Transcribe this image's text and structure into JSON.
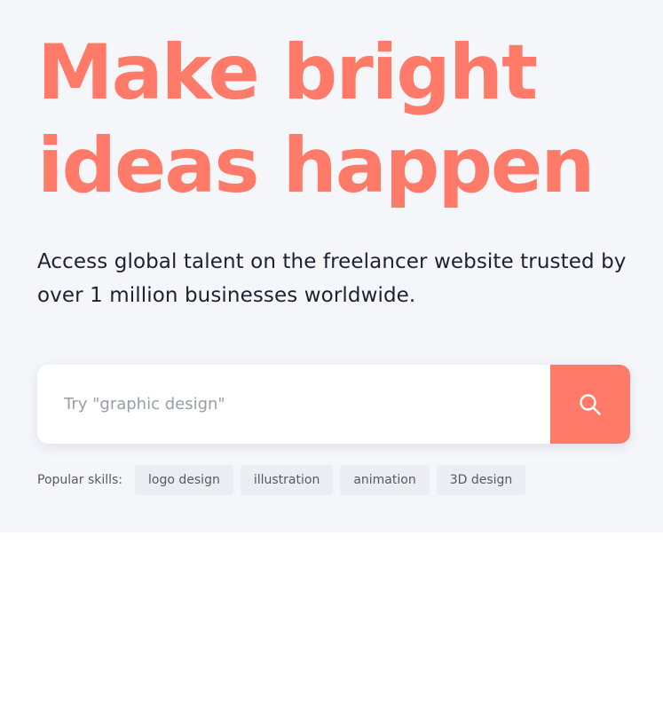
{
  "hero": {
    "headline_line1": "Make bright",
    "headline_line2": "ideas happen",
    "subheadline": "Access global talent on the freelancer website trusted by over 1 million businesses worldwide."
  },
  "search": {
    "placeholder": "Try \"graphic design\"",
    "button_icon": "search-icon"
  },
  "skills": {
    "label": "Popular skills:",
    "items": [
      "logo design",
      "illustration",
      "animation",
      "3D design"
    ]
  },
  "colors": {
    "accent": "#ff7a68",
    "hero_background": "#f5f6fa",
    "text_dark": "#1d2130",
    "chip_background": "#ebedf2"
  }
}
